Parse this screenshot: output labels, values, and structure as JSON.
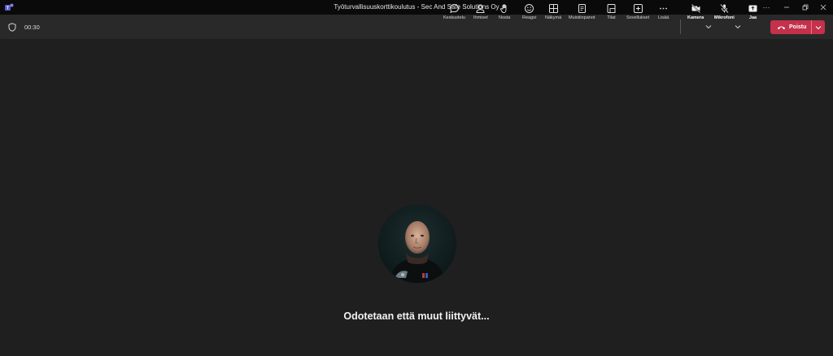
{
  "window": {
    "title": "Työturvallisuuskorttikoulutus - Sec And Safe Solutions Oy",
    "controls": [
      "more-icon",
      "minimize-icon",
      "restore-icon",
      "close-icon"
    ]
  },
  "meeting": {
    "timer": "00:30"
  },
  "toolbar": {
    "chat": "Keskustelu",
    "people": "Ihmiset",
    "raise": "Nosta",
    "react": "Reagoi",
    "view": "Näkymä",
    "notes": "Muistiinpanot",
    "rooms": "Tilat",
    "apps": "Sovellukset",
    "more": "Lisää",
    "camera": "Kamera",
    "mic": "Mikrofoni",
    "share": "Jaa",
    "leave": "Poistu"
  },
  "colors": {
    "background": "#1f1f1f",
    "toolbar": "#292929",
    "leave_button": "#c4314b"
  },
  "stage": {
    "status_text": "Odotetaan että muut liittyvät..."
  }
}
